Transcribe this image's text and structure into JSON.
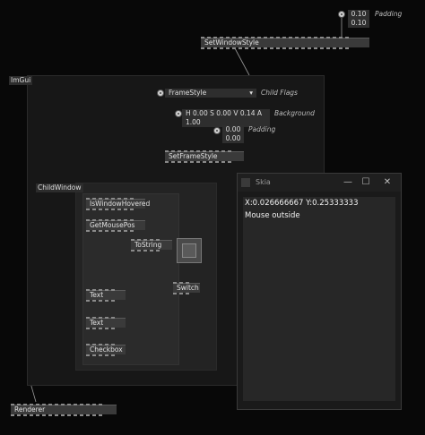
{
  "colors": {
    "background": "#080808",
    "node": "#3a3a3a",
    "region": "#1c1c1c",
    "window_body": "#272727"
  },
  "padding_top": {
    "values": [
      "0.10",
      "0.10"
    ],
    "label": "Padding"
  },
  "set_window_style": {
    "label": "SetWindowStyle"
  },
  "imgui_region": {
    "label": "ImGui"
  },
  "frame_style": {
    "label": "FrameStyle",
    "child_flags_label": "Child Flags",
    "dropdown_icon": "chevron-down-icon"
  },
  "background_color": {
    "value": "H 0.00 S 0.00 V 0.14 A 1.00",
    "label": "Background"
  },
  "padding_frame": {
    "values": [
      "0.00",
      "0.00"
    ],
    "label": "Padding"
  },
  "set_frame_style": {
    "label": "SetFrameStyle"
  },
  "child_window": {
    "label": "ChildWindow"
  },
  "nodes": {
    "is_window_hovered": "IsWindowHovered",
    "get_mouse_pos": "GetMousePos",
    "to_string": "ToString",
    "switch": "Switch",
    "text1": "Text",
    "text2": "Text",
    "checkbox": "Checkbox"
  },
  "renderer": {
    "label": "Renderer"
  },
  "skia_window": {
    "title": "Skia",
    "line1": "X:0.026666667 Y:0.25333333",
    "line2": "Mouse outside",
    "minimize_icon": "minimize-icon",
    "maximize_icon": "maximize-icon",
    "close_icon": "close-icon"
  }
}
